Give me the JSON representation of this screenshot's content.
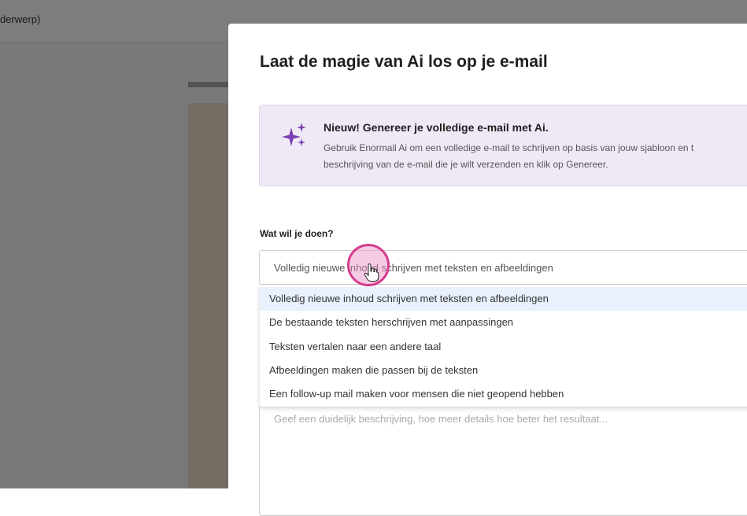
{
  "background": {
    "topbar_text": "derwerp)"
  },
  "modal": {
    "title": "Laat de magie van Ai los op je e-mail",
    "banner": {
      "icon": "sparkle-icon",
      "title": "Nieuw! Genereer je volledige e-mail met Ai.",
      "body_line1": "Gebruik Enormail Ai om een volledige e-mail te schrijven op basis van jouw sjabloon en t",
      "body_line2": "beschrijving van de e-mail die je wilt verzenden en klik op Genereer."
    },
    "action_field": {
      "label": "Wat wil je doen?",
      "value": "Volledig nieuwe inhoud schrijven met teksten en afbeeldingen",
      "options": [
        "Volledig nieuwe inhoud schrijven met teksten en afbeeldingen",
        "De bestaande teksten herschrijven met aanpassingen",
        "Teksten vertalen naar een andere taal",
        "Afbeeldingen maken die passen bij de teksten",
        "Een follow-up mail maken voor mensen die niet geopend hebben"
      ],
      "selected_index": 0
    },
    "description_field": {
      "placeholder": "Geef een duidelijk beschrijving, hoe meer details hoe beter het resultaat..."
    }
  },
  "colors": {
    "accent_purple": "#7a3fb0",
    "banner_bg": "#efe9f6",
    "click_ring": "#d43c8d",
    "selected_option_bg": "#e8f1fd"
  }
}
